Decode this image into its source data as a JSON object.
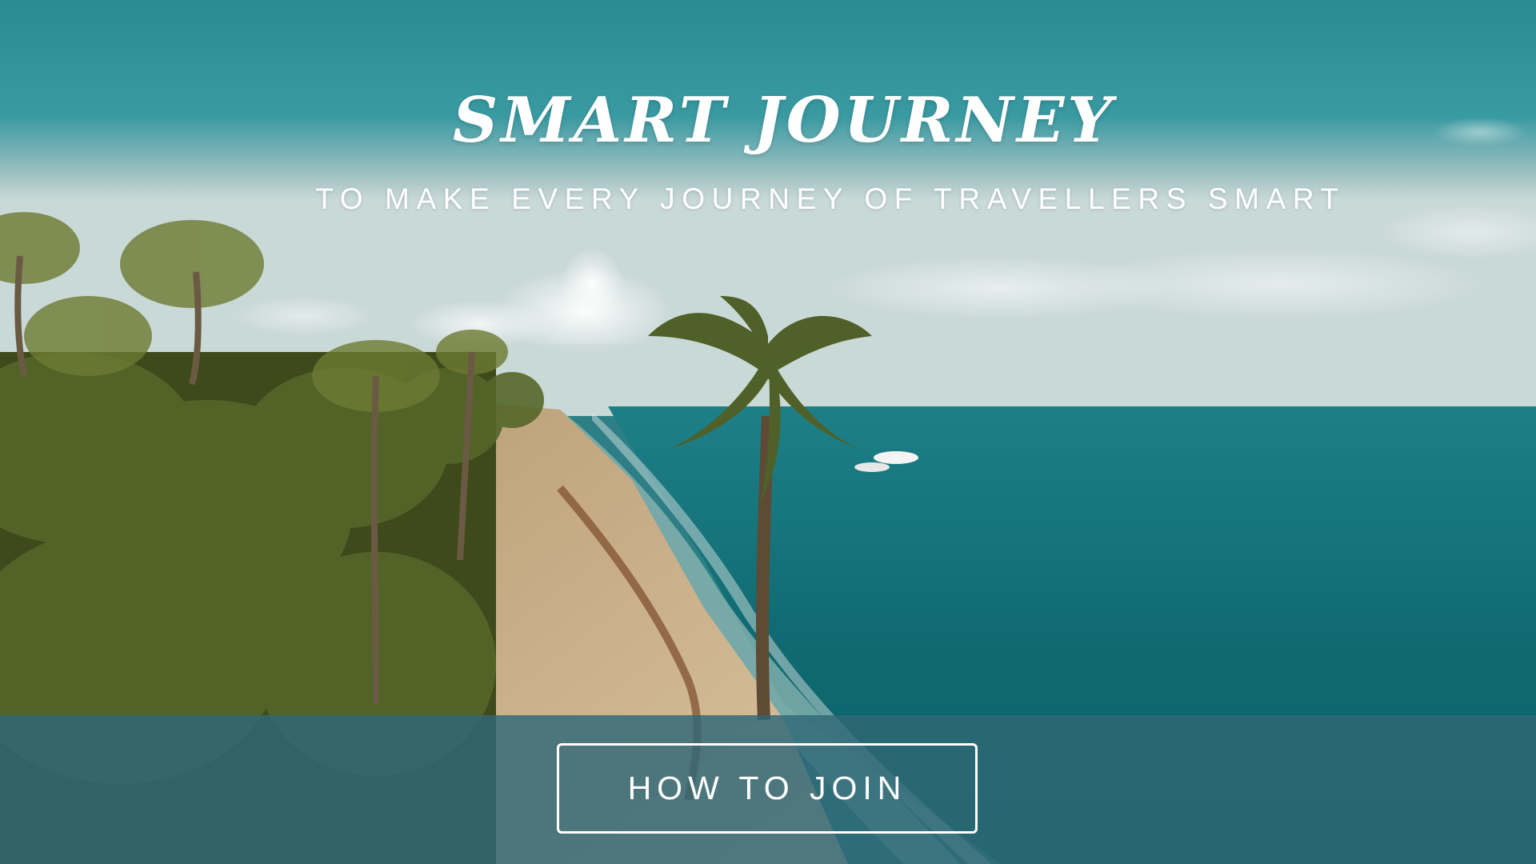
{
  "hero": {
    "title": "SMART JOURNEY",
    "subtitle": "TO MAKE EVERY JOURNEY OF TRAVELLERS SMART",
    "cta_label": "HOW TO JOIN",
    "background_image": "tropical beach with palm trees and turquoise sea"
  },
  "colors": {
    "sky": "#2f8b91",
    "sea": "#0f6f74",
    "sand": "#cdb28c",
    "palm": "#4b5a22",
    "band": "#306876",
    "text": "#ffffff"
  }
}
